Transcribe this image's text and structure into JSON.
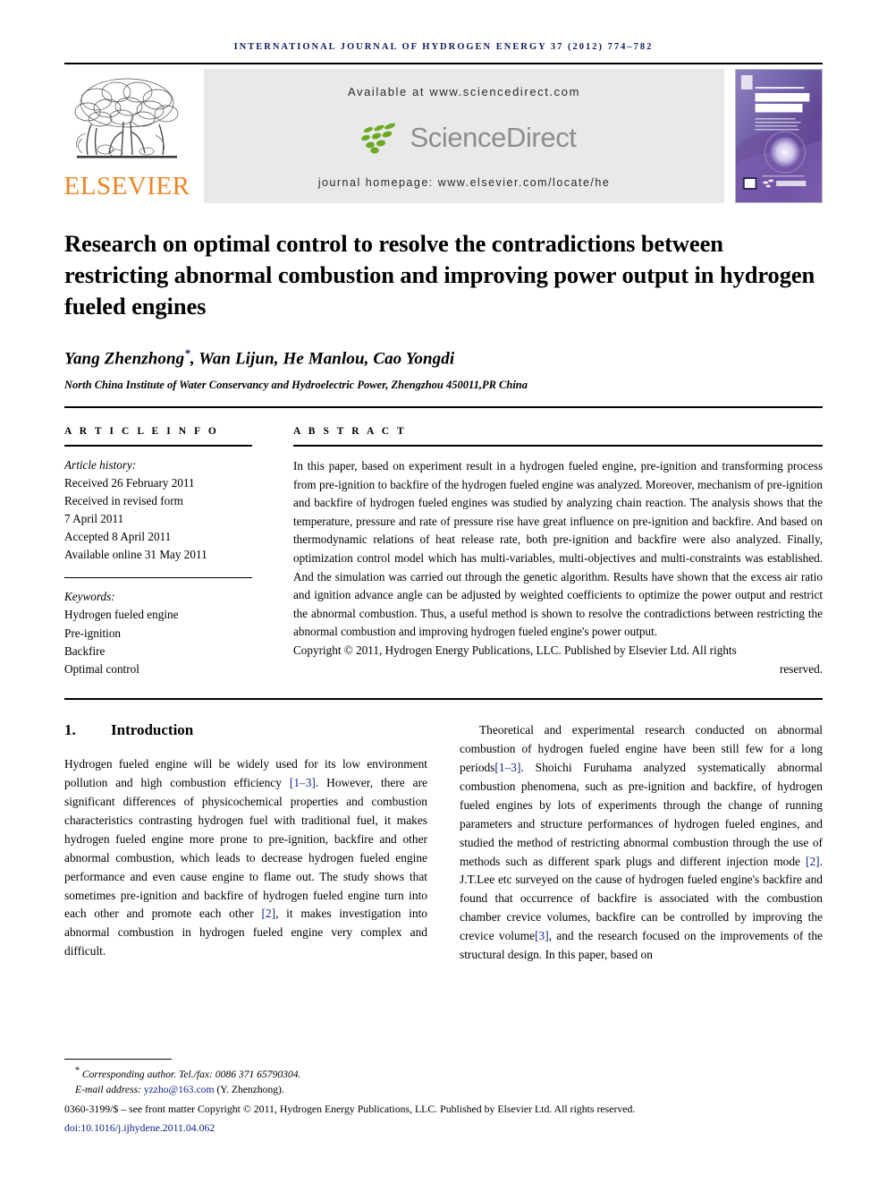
{
  "running_head": "International Journal of Hydrogen Energy 37 (2012) 774–782",
  "masthead": {
    "publisher_wordmark": "ELSEVIER",
    "available_at": "Available at www.sciencedirect.com",
    "sciencedirect_word": "ScienceDirect",
    "journal_homepage": "journal homepage: www.elsevier.com/locate/he",
    "cover": {
      "line1": "International Journal of",
      "line2": "HYDROGEN",
      "line3": "ENERGY",
      "footer_logo": "ScienceDirect"
    },
    "colors": {
      "elsevier_orange": "#F08322",
      "sciencedirect_green": "#6aaa23",
      "sciencedirect_gray": "#8d8d8d",
      "banner_bg": "#e9e9e9",
      "running_head_blue": "#0f1a63",
      "link_blue": "#12248c"
    }
  },
  "article": {
    "title": "Research on optimal control to resolve the contradictions between restricting abnormal combustion and improving power output in hydrogen fueled engines",
    "authors": "Yang Zhenzhong",
    "authors_rest": ", Wan Lijun, He Manlou, Cao Yongdi",
    "corresponding_marker": "*",
    "affiliation": "North China Institute of Water Conservancy and Hydroelectric Power, Zhengzhou 450011,PR China"
  },
  "article_info": {
    "heading": "A R T I C L E   I N F O",
    "history_label": "Article history:",
    "history": [
      "Received 26 February 2011",
      "Received in revised form",
      "7 April 2011",
      "Accepted 8 April 2011",
      "Available online 31 May 2011"
    ],
    "keywords_label": "Keywords:",
    "keywords": [
      "Hydrogen fueled engine",
      "Pre-ignition",
      "Backfire",
      "Optimal control"
    ]
  },
  "abstract": {
    "heading": "A B S T R A C T",
    "body": "In this paper, based on experiment result in a hydrogen fueled engine, pre-ignition and transforming process from pre-ignition to backfire of the hydrogen fueled engine was analyzed. Moreover, mechanism of pre-ignition and backfire of hydrogen fueled engines was studied by analyzing chain reaction. The analysis shows that the temperature, pressure and rate of pressure rise have great influence on pre-ignition and backfire. And based on thermodynamic relations of heat release rate, both pre-ignition and backfire were also analyzed. Finally, optimization control model which has multi-variables, multi-objectives and multi-constraints was established. And the simulation was carried out through the genetic algorithm. Results have shown that the excess air ratio and ignition advance angle can be adjusted by weighted coefficients to optimize the power output and restrict the abnormal combustion. Thus, a useful method is shown to resolve the contradictions between restricting the abnormal combustion and improving hydrogen fueled engine's power output.",
    "copyright": "Copyright © 2011, Hydrogen Energy Publications, LLC. Published by Elsevier Ltd. All rights",
    "copyright_tail": "reserved."
  },
  "section": {
    "number": "1.",
    "title": "Introduction"
  },
  "body": {
    "left_p1_a": "Hydrogen fueled engine will be widely used for its low environment pollution and high combustion efficiency ",
    "left_p1_ref": "[1–3]",
    "left_p1_b": ". However, there are significant differences of physicochemical properties and combustion characteristics contrasting hydrogen fuel with traditional fuel, it makes hydrogen fueled engine more prone to pre-ignition, backfire and other abnormal combustion, which leads to decrease hydrogen fueled engine performance and even cause engine to flame out. The study shows that sometimes pre-ignition and backfire of hydrogen fueled engine turn into each other and promote each other ",
    "left_p1_ref2": "[2]",
    "left_p1_c": ", it makes investigation into abnormal combustion in hydrogen fueled engine very complex and difficult.",
    "right_p1_a": "Theoretical and experimental research conducted on abnormal combustion of hydrogen fueled engine have been still few for a long periods",
    "right_p1_ref": "[1–3]",
    "right_p1_b": ". Shoichi Furuhama analyzed systematically abnormal combustion phenomena, such as pre-ignition and backfire, of hydrogen fueled engines by lots of experiments through the change of running parameters and structure performances of hydrogen fueled engines, and studied the method of restricting abnormal combustion through the use of methods such as different spark plugs and different injection mode ",
    "right_p1_ref2": "[2]",
    "right_p1_c": ". J.T.Lee etc surveyed on the cause of hydrogen fueled engine's backfire and found that occurrence of backfire is associated with the combustion chamber crevice volumes, backfire can be controlled by improving the crevice volume",
    "right_p1_ref3": "[3]",
    "right_p1_d": ", and the research focused on the improvements of the structural design. In this paper, based on"
  },
  "footnotes": {
    "corresponding": "Corresponding author. Tel./fax: 0086 371 65790304.",
    "email_label": "E-mail address: ",
    "email": "yzzho@163.com",
    "email_tail": " (Y. Zhenzhong).",
    "imprint": "0360-3199/$ – see front matter Copyright © 2011, Hydrogen Energy Publications, LLC. Published by Elsevier Ltd. All rights reserved.",
    "doi_label": "doi:",
    "doi": "10.1016/j.ijhydene.2011.04.062"
  }
}
